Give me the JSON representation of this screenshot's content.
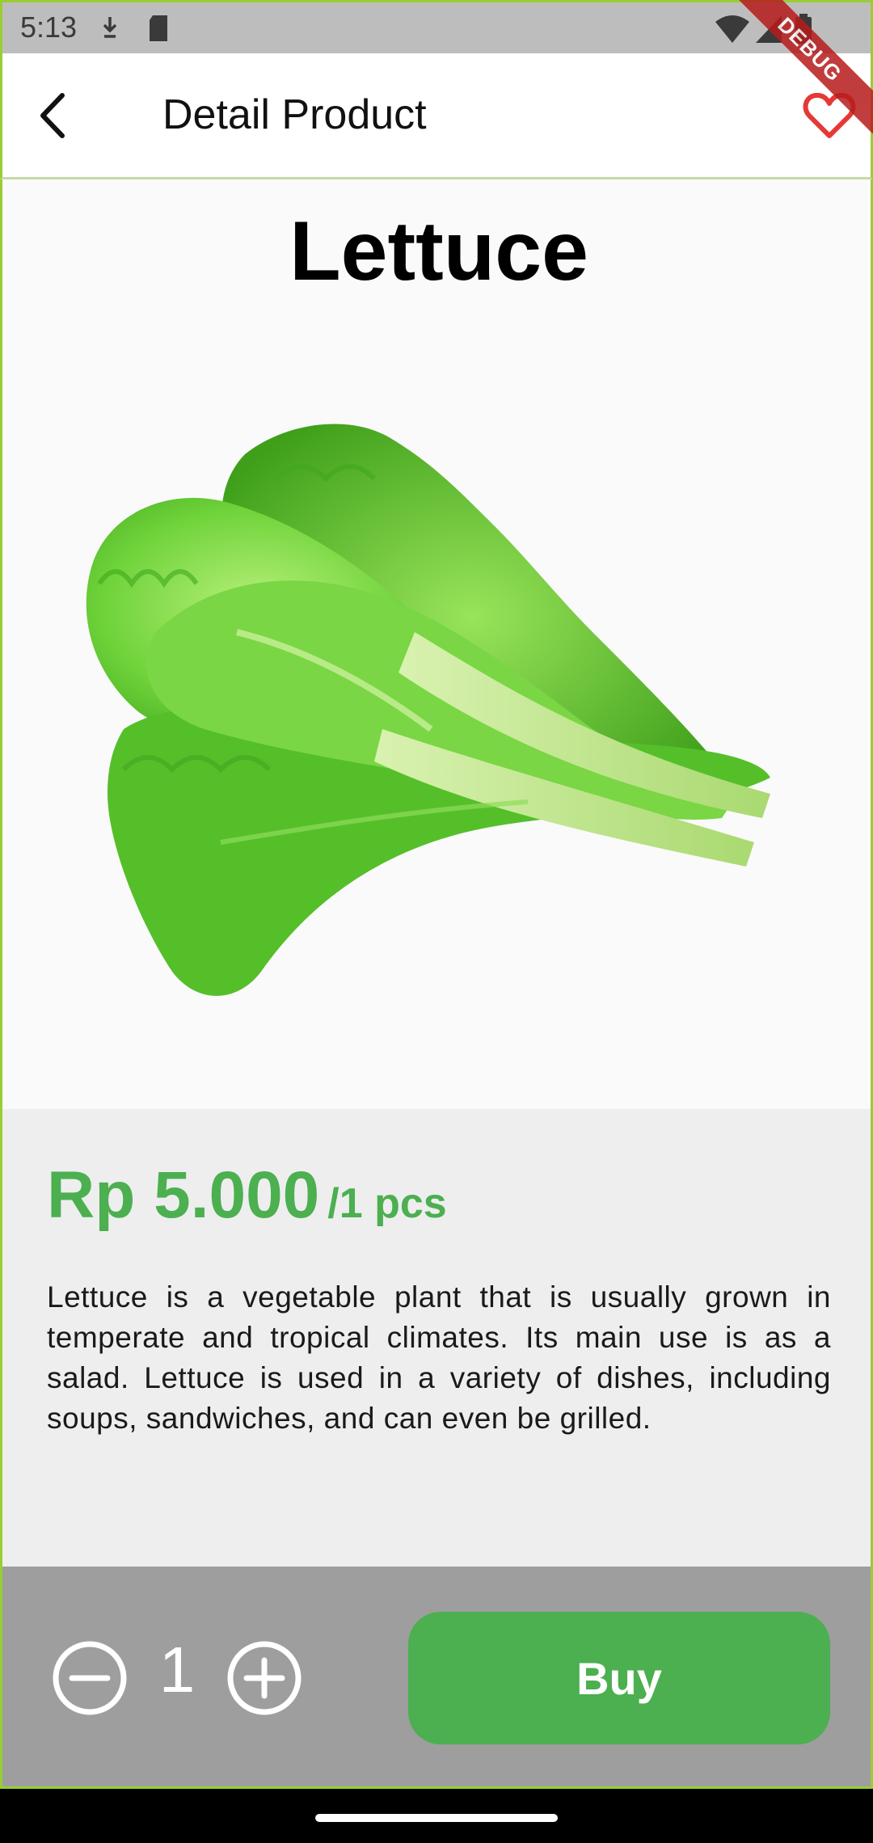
{
  "status_bar": {
    "time": "5:13",
    "icons": [
      "download-icon",
      "sd-card-icon",
      "wifi-icon",
      "signal-icon",
      "battery-icon"
    ]
  },
  "app_bar": {
    "title": "Detail Product",
    "back_icon": "arrow-back-icon",
    "favorite_icon": "heart-outline-icon",
    "favorite_color": "#e53935"
  },
  "debug_banner": "DEBUG",
  "product": {
    "name": "Lettuce",
    "image": "lettuce-image",
    "price": "Rp 5.000",
    "unit": "/1 pcs",
    "description": "Lettuce is a vegetable plant that is usually grown in temperate and tropical climates. Its main use is as a salad. Lettuce is used in a variety of dishes, including soups, sandwiches, and can even be grilled."
  },
  "cart": {
    "quantity": "1",
    "minus_icon": "minus-circle-icon",
    "plus_icon": "plus-circle-icon",
    "buy_label": "Buy"
  },
  "colors": {
    "accent": "#4caf50",
    "bottom_bar": "#9e9e9e",
    "info_panel": "#eeeeee"
  }
}
